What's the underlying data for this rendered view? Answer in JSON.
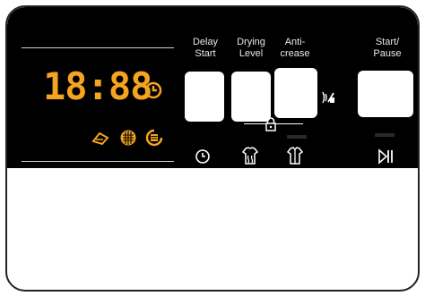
{
  "display": {
    "time": "18:88"
  },
  "buttons": [
    {
      "id": "delay-start",
      "label_line1": "Delay",
      "label_line2": "Start",
      "icon": "clock-icon"
    },
    {
      "id": "drying-level",
      "label_line1": "Drying",
      "label_line2": "Level",
      "icon": "shirt-steam-icon"
    },
    {
      "id": "anti-crease",
      "label_line1": "Anti-",
      "label_line2": "crease",
      "icon": "shirt-fold-icon"
    },
    {
      "id": "start-pause",
      "label_line1": "Start/",
      "label_line2": "Pause",
      "icon": "play-pause-icon"
    }
  ],
  "colors": {
    "panel": "#000000",
    "segment": "#f5a41f",
    "label": "#e8e8e8",
    "button": "#ffffff"
  }
}
